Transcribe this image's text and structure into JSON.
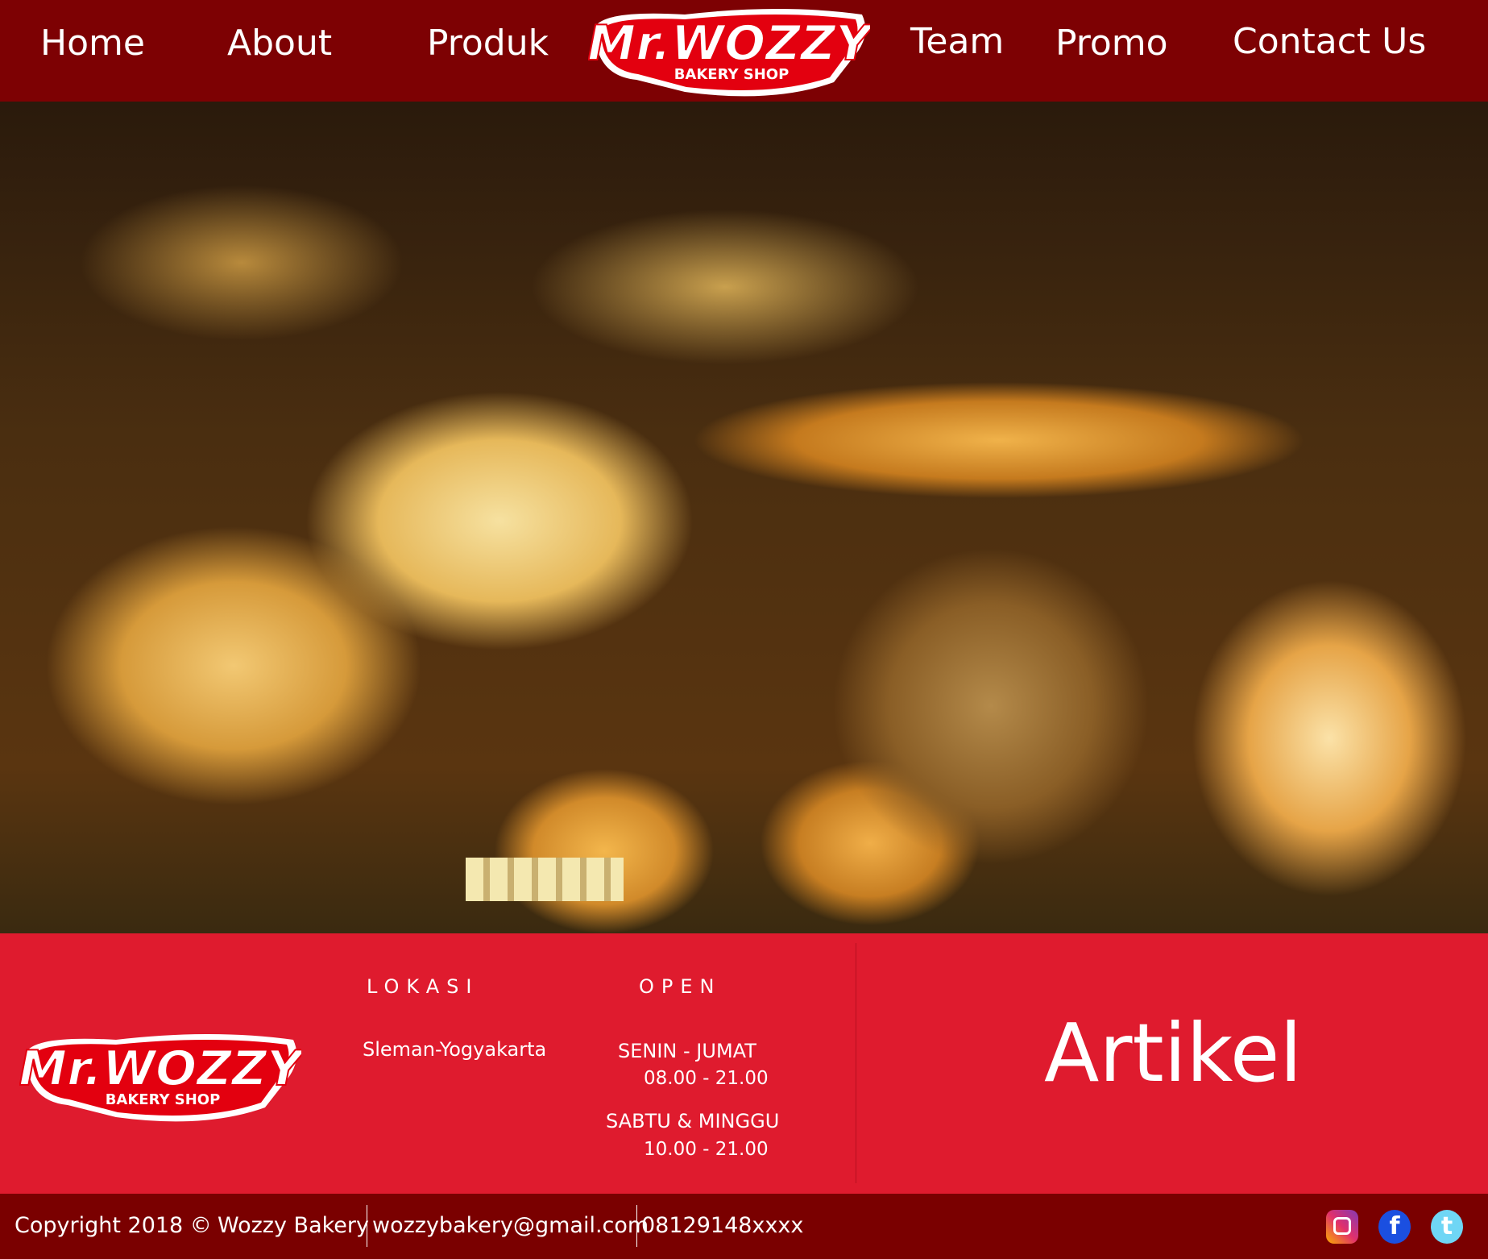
{
  "nav": {
    "items": [
      "Home",
      "About",
      "Produk",
      "Team",
      "Promo",
      "Contact Us"
    ]
  },
  "logo": {
    "title": "Mr.WOZZY",
    "subtitle": "BAKERY SHOP"
  },
  "info": {
    "lokasi_label": "LOKASI",
    "lokasi_value": "Sleman-Yogyakarta",
    "open_label": "OPEN",
    "weekday": "SENIN - JUMAT",
    "weekday_hours": "08.00 - 21.00",
    "weekend": "SABTU & MINGGU",
    "weekend_hours": "10.00 - 21.00",
    "artikel": "Artikel"
  },
  "footer": {
    "copyright": "Copyright 2018 ©",
    "name": "Wozzy Bakery",
    "email": "wozzybakery@gmail.com",
    "phone": "08129148xxxx",
    "icons": [
      "instagram-icon",
      "facebook-icon",
      "twitter-icon"
    ],
    "facebook_glyph": "f",
    "twitter_glyph": "t"
  },
  "colors": {
    "nav": "#7d0103",
    "info": "#df1b2e",
    "footer": "#7a0000"
  }
}
